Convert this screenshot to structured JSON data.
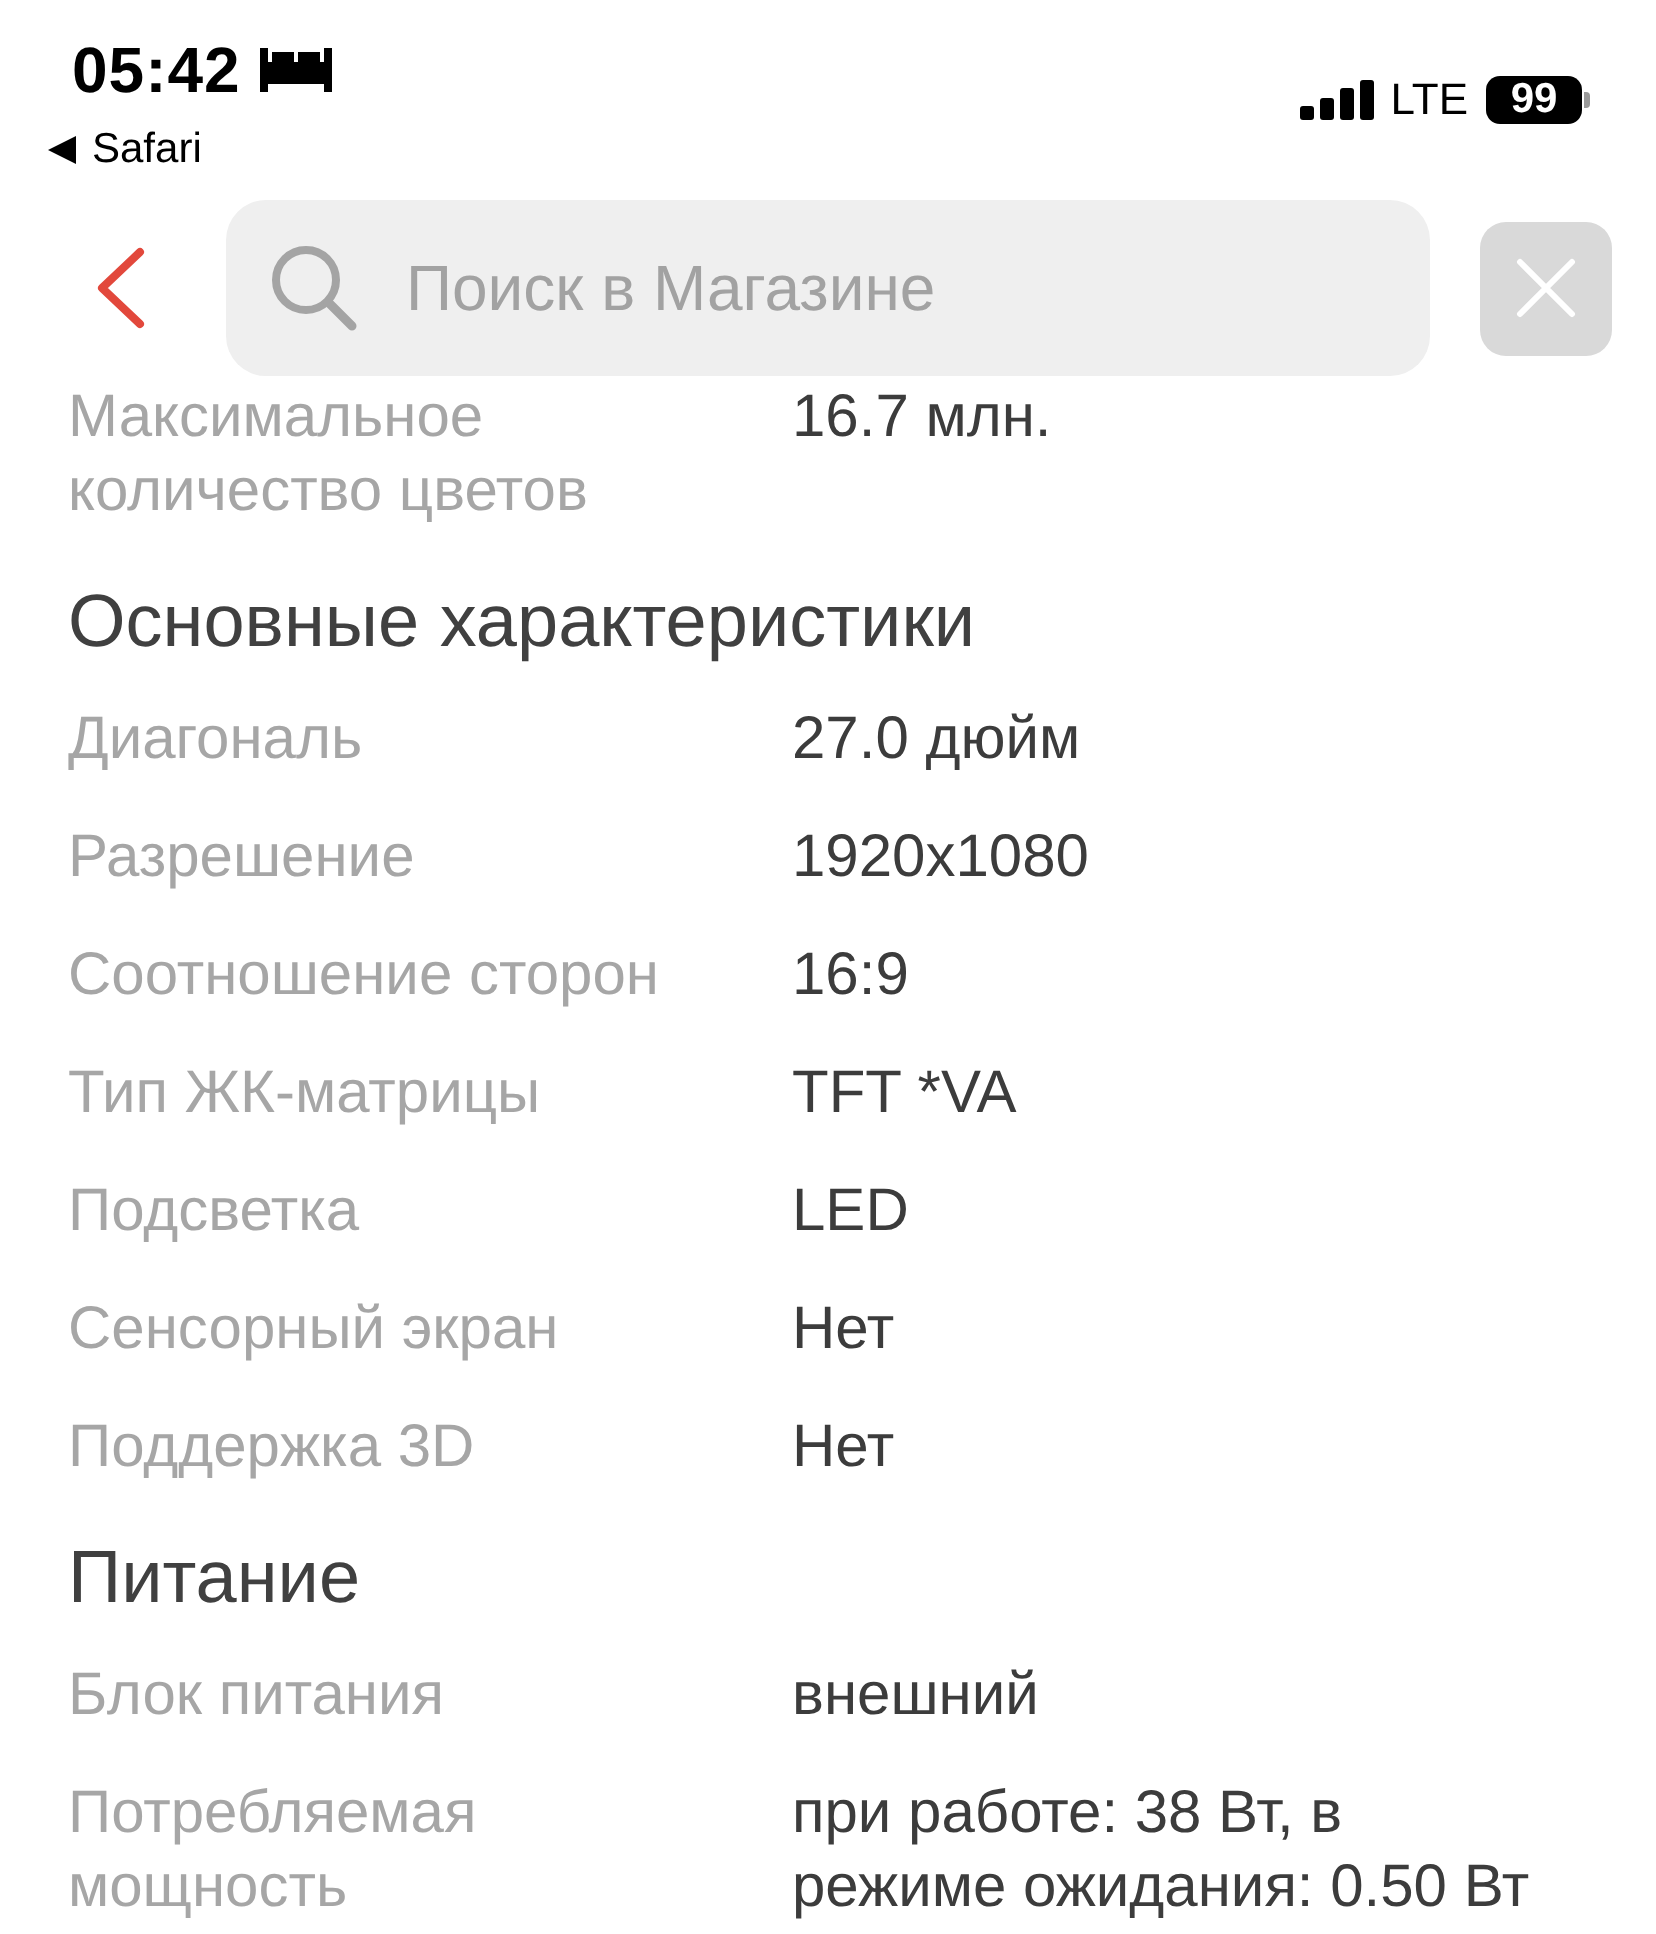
{
  "status_bar": {
    "time": "05:42",
    "back_app": "Safari",
    "network": "LTE",
    "battery": "99"
  },
  "header": {
    "search": {
      "placeholder": "Поиск в Магазине"
    }
  },
  "sections": [
    {
      "rows": [
        {
          "label": "Максимальное количество цветов",
          "value": "16.7 млн."
        }
      ]
    },
    {
      "title": "Основные характеристики",
      "rows": [
        {
          "label": "Диагональ",
          "value": "27.0 дюйм"
        },
        {
          "label": "Разрешение",
          "value": "1920x1080"
        },
        {
          "label": "Соотношение сторон",
          "value": "16:9"
        },
        {
          "label": "Тип ЖК-матрицы",
          "value": "TFT *VA"
        },
        {
          "label": "Подсветка",
          "value": "LED"
        },
        {
          "label": "Сенсорный экран",
          "value": "Нет"
        },
        {
          "label": "Поддержка 3D",
          "value": "Нет"
        }
      ]
    },
    {
      "title": "Питание",
      "rows": [
        {
          "label": "Блок питания",
          "value": "внешний"
        },
        {
          "label": "Потребляемая мощность",
          "value": "при работе: 38 Вт, в режиме ожидания: 0.50 Вт"
        }
      ]
    }
  ]
}
